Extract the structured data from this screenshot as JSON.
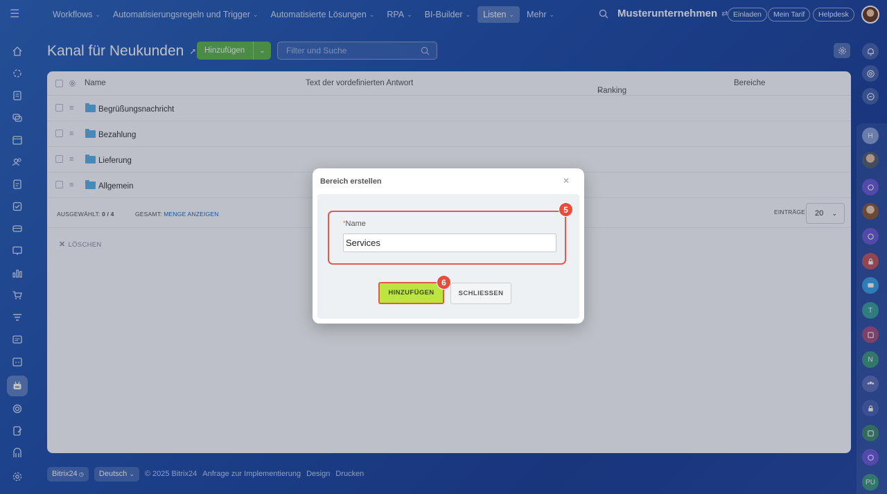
{
  "topnav": {
    "items": [
      {
        "label": "Workflows",
        "has_caret": true,
        "active": false
      },
      {
        "label": "Automatisierungsregeln und Trigger",
        "has_caret": true,
        "active": false
      },
      {
        "label": "Automatisierte Lösungen",
        "has_caret": true,
        "active": false
      },
      {
        "label": "RPA",
        "has_caret": true,
        "active": false
      },
      {
        "label": "BI-Builder",
        "has_caret": true,
        "active": false
      },
      {
        "label": "Listen",
        "has_caret": true,
        "active": true
      },
      {
        "label": "Mehr",
        "has_caret": true,
        "active": false
      }
    ],
    "company": "Musterunternehmen",
    "invite": "Einladen",
    "plan": "Mein Tarif",
    "helpdesk": "Helpdesk"
  },
  "page": {
    "title": "Kanal für Neukunden",
    "add_label": "Hinzufügen",
    "filter_placeholder": "Filter und Suche"
  },
  "table": {
    "columns": {
      "name": "Name",
      "text": "Text der vordefinierten Antwort",
      "ranking": "Ranking",
      "areas": "Bereiche"
    },
    "rows": [
      {
        "name": "Begrüßungsnachricht"
      },
      {
        "name": "Bezahlung"
      },
      {
        "name": "Lieferung"
      },
      {
        "name": "Allgemein"
      }
    ],
    "selected_label": "AUSGEWÄHLT:",
    "selected_value": "0 / 4",
    "total_label": "GESAMT:",
    "total_link": "MENGE ANZEIGEN",
    "entries_label": "EINTRÄGE",
    "page_size": "20",
    "delete_label": "LÖSCHEN"
  },
  "footer": {
    "brand": "Bitrix24",
    "language": "Deutsch",
    "copyright": "© 2025 Bitrix24",
    "request": "Anfrage zur Implementierung",
    "design": "Design",
    "print": "Drucken"
  },
  "modal": {
    "title": "Bereich erstellen",
    "field_label": "Name",
    "field_value": "Services",
    "add_button": "HINZUFÜGEN",
    "close_button": "SCHLIESSEN",
    "badge_field": "5",
    "badge_button": "6"
  },
  "rightbar": {
    "initials": [
      "H",
      "T",
      "N",
      "PU"
    ]
  },
  "colors": {
    "accent_green": "#5fb84a",
    "highlight_green": "#bde53f",
    "annotation_red": "#e94b3c"
  }
}
